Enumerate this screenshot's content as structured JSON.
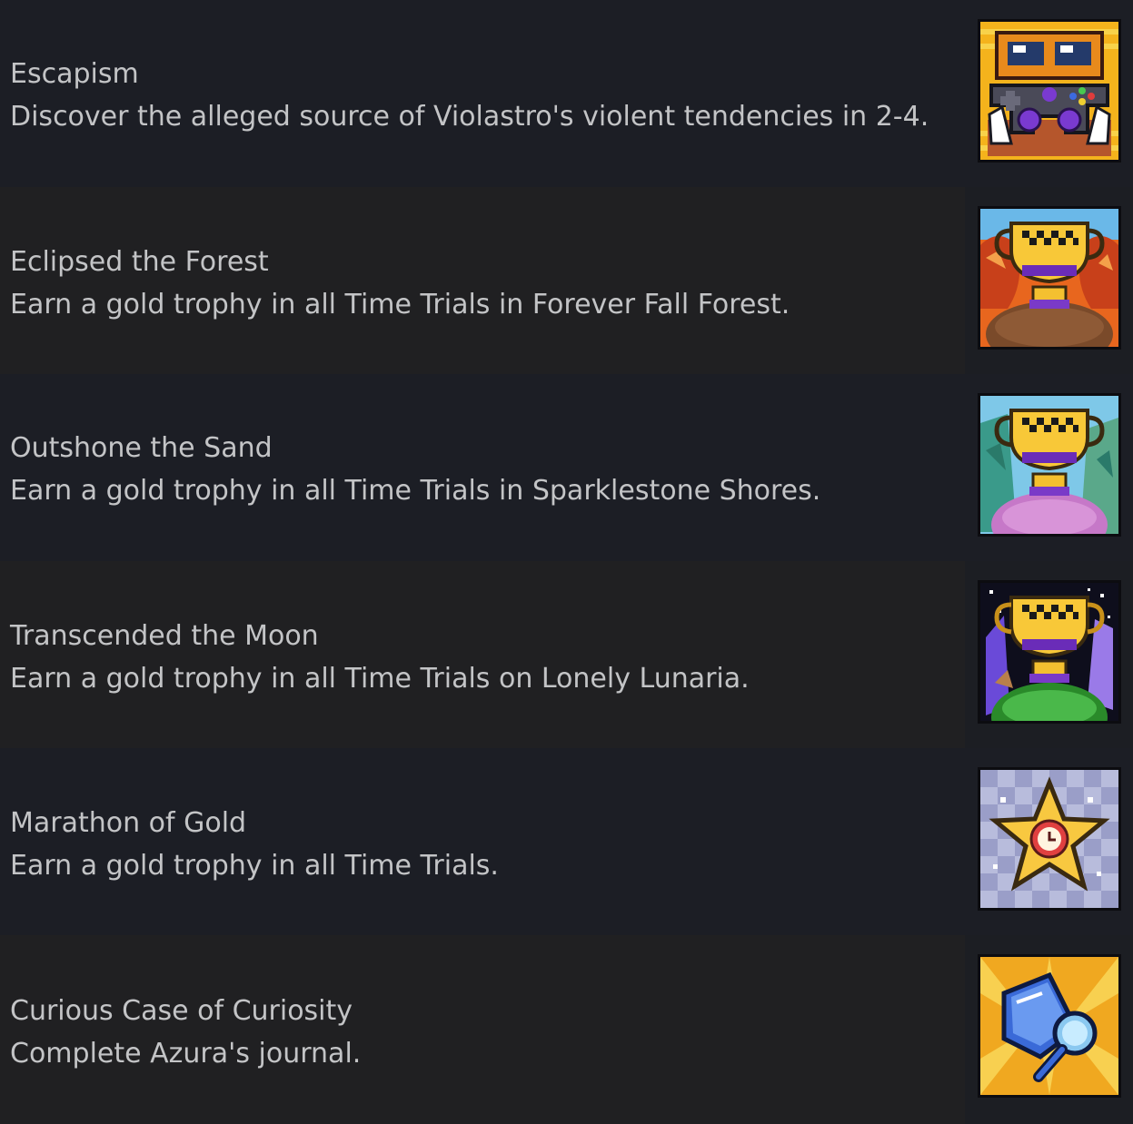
{
  "achievements": [
    {
      "title": "Escapism",
      "description": "Discover the alleged source of Violastro's violent tendencies in 2-4.",
      "icon": "gamepad-icon"
    },
    {
      "title": "Eclipsed the Forest",
      "description": "Earn a gold trophy in all Time Trials in Forever Fall Forest.",
      "icon": "forest-trophy-icon"
    },
    {
      "title": "Outshone the Sand",
      "description": "Earn a gold trophy in all Time Trials in Sparklestone Shores.",
      "icon": "sand-trophy-icon"
    },
    {
      "title": "Transcended the Moon",
      "description": "Earn a gold trophy in all Time Trials on Lonely Lunaria.",
      "icon": "moon-trophy-icon"
    },
    {
      "title": "Marathon of Gold",
      "description": "Earn a gold trophy in all Time Trials.",
      "icon": "gold-star-clock-icon"
    },
    {
      "title": "Curious Case of Curiosity",
      "description": "Complete Azura's journal.",
      "icon": "journal-magnifier-icon"
    }
  ]
}
